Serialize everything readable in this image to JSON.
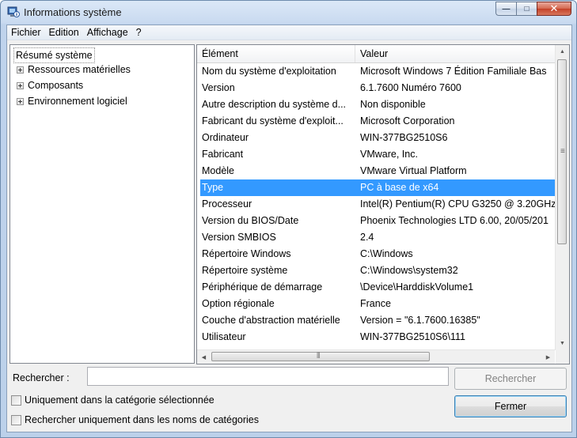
{
  "window": {
    "title": "Informations système",
    "minimize_glyph": "—",
    "maximize_glyph": "□",
    "close_glyph": "✕"
  },
  "menu": [
    "Fichier",
    "Edition",
    "Affichage",
    "?"
  ],
  "tree": {
    "root": "Résumé système",
    "children": [
      "Ressources matérielles",
      "Composants",
      "Environnement logiciel"
    ]
  },
  "table": {
    "headers": [
      "Élément",
      "Valeur"
    ],
    "selected_index": 7,
    "rows": [
      [
        "Nom du système d'exploitation",
        "Microsoft Windows 7 Édition Familiale Bas"
      ],
      [
        "Version",
        "6.1.7600 Numéro 7600"
      ],
      [
        "Autre description du système d...",
        "Non disponible"
      ],
      [
        "Fabricant du système d'exploit...",
        "Microsoft Corporation"
      ],
      [
        "Ordinateur",
        "WIN-377BG2510S6"
      ],
      [
        "Fabricant",
        "VMware, Inc."
      ],
      [
        "Modèle",
        "VMware Virtual Platform"
      ],
      [
        "Type",
        "PC à base de x64"
      ],
      [
        "Processeur",
        "Intel(R) Pentium(R) CPU G3250 @ 3.20GHz,"
      ],
      [
        "Version du BIOS/Date",
        "Phoenix Technologies LTD 6.00, 20/05/201"
      ],
      [
        "Version SMBIOS",
        "2.4"
      ],
      [
        "Répertoire Windows",
        "C:\\Windows"
      ],
      [
        "Répertoire système",
        "C:\\Windows\\system32"
      ],
      [
        "Périphérique de démarrage",
        "\\Device\\HarddiskVolume1"
      ],
      [
        "Option régionale",
        "France"
      ],
      [
        "Couche d'abstraction matérielle",
        "Version = \"6.1.7600.16385\""
      ],
      [
        "Utilisateur",
        "WIN-377BG2510S6\\111"
      ]
    ]
  },
  "search": {
    "label": "Rechercher :",
    "value": "",
    "button": "Rechercher",
    "button_enabled": false
  },
  "options": [
    {
      "label": "Uniquement dans la catégorie sélectionnée",
      "checked": false
    },
    {
      "label": "Rechercher uniquement dans les noms de catégories",
      "checked": false
    }
  ],
  "close_button": "Fermer",
  "colors": {
    "selection": "#3399ff",
    "frame": "#bcd1ea"
  }
}
